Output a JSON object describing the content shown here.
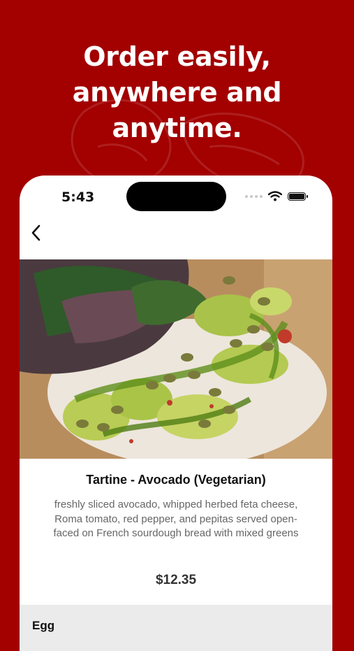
{
  "headline": {
    "line1": "Order easily,",
    "line2": "anywhere and",
    "line3": "anytime."
  },
  "status_bar": {
    "time": "5:43",
    "icons": [
      "signal-dots-icon",
      "wifi-icon",
      "battery-icon"
    ]
  },
  "nav": {
    "back_icon": "chevron-left-icon"
  },
  "item": {
    "title": "Tartine - Avocado (Vegetarian)",
    "description": "freshly sliced avocado, whipped herbed feta cheese, Roma tomato, red pepper, and pepitas served open-faced on French sourdough bread with mixed greens",
    "price": "$12.35"
  },
  "options": {
    "section_label": "Egg"
  },
  "colors": {
    "brand": "#a30000",
    "card": "#ffffff",
    "section_bg": "#ebebeb"
  }
}
